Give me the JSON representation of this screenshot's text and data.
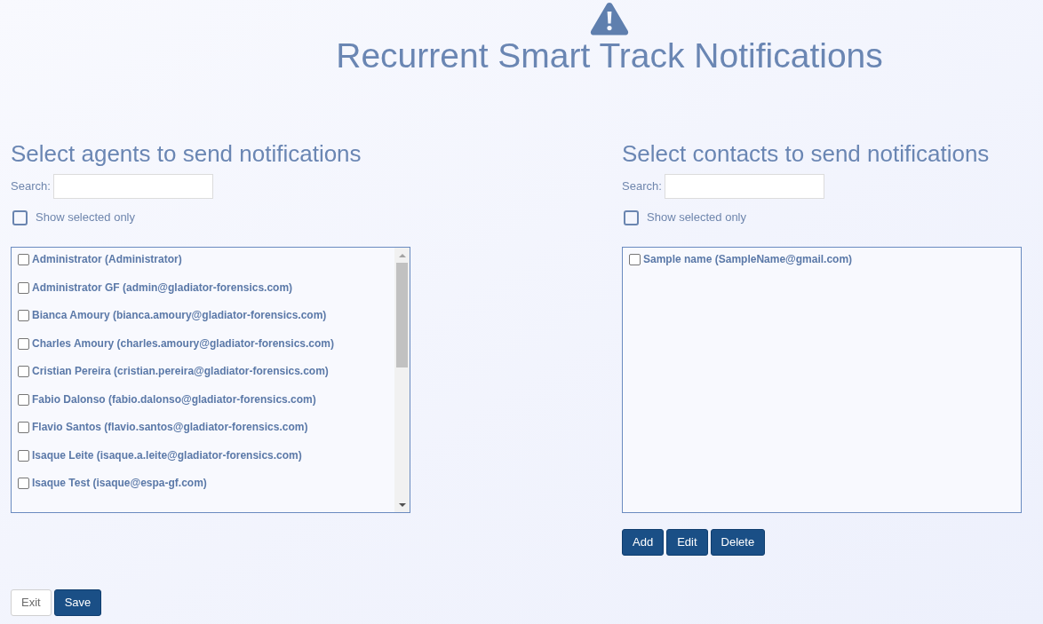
{
  "header": {
    "title": "Recurrent Smart Track Notifications"
  },
  "agents": {
    "heading": "Select agents to send notifications",
    "search": {
      "label": "Search:"
    },
    "show_selected_only": {
      "label": "Show selected only",
      "checked": false
    },
    "items": [
      {
        "label": "Administrator (Administrator)",
        "checked": false
      },
      {
        "label": "Administrator GF (admin@gladiator-forensics.com)",
        "checked": false
      },
      {
        "label": "Bianca Amoury (bianca.amoury@gladiator-forensics.com)",
        "checked": false
      },
      {
        "label": "Charles Amoury (charles.amoury@gladiator-forensics.com)",
        "checked": false
      },
      {
        "label": "Cristian Pereira (cristian.pereira@gladiator-forensics.com)",
        "checked": false
      },
      {
        "label": "Fabio Dalonso (fabio.dalonso@gladiator-forensics.com)",
        "checked": false
      },
      {
        "label": "Flavio Santos (flavio.santos@gladiator-forensics.com)",
        "checked": false
      },
      {
        "label": "Isaque Leite (isaque.a.leite@gladiator-forensics.com)",
        "checked": false
      },
      {
        "label": "Isaque Test (isaque@espa-gf.com)",
        "checked": false
      }
    ]
  },
  "contacts": {
    "heading": "Select contacts to send notifications",
    "search": {
      "label": "Search:"
    },
    "show_selected_only": {
      "label": "Show selected only",
      "checked": false
    },
    "items": [
      {
        "label": "Sample name (SampleName@gmail.com)",
        "checked": false
      }
    ],
    "buttons": [
      "Add",
      "Edit",
      "Delete"
    ]
  },
  "footer_buttons": [
    {
      "label": "Exit",
      "kind": "secondary"
    },
    {
      "label": "Save",
      "kind": "primary"
    }
  ]
}
